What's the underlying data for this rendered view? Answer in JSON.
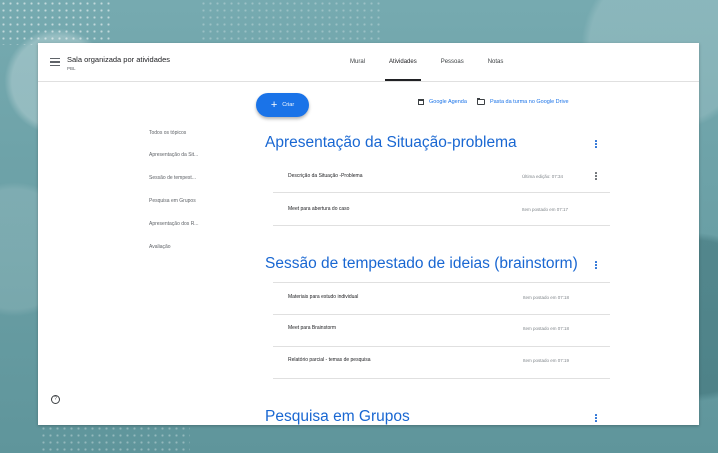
{
  "header": {
    "class_name": "Sala organizada por atividades",
    "class_sub": "PBL"
  },
  "tabs": [
    {
      "label": "Mural"
    },
    {
      "label": "Atividades"
    },
    {
      "label": "Pessoas"
    },
    {
      "label": "Notas"
    }
  ],
  "actions": {
    "create_label": "Criar",
    "calendar_link": "Google Agenda",
    "drive_link": "Pasta da turma no Google Drive"
  },
  "topics": [
    "Todos os tópicos",
    "Apresentação da Sit...",
    "Sessão de tempest...",
    "Pesquisa em Grupos",
    "Apresentação dos R...",
    "Avaliação"
  ],
  "sections": [
    {
      "title": "Apresentação da Situação-problema",
      "items": [
        {
          "title": "Descrição da Situação -Problema",
          "meta": "Última edição: 07:34"
        },
        {
          "title": "Meet para abertura do caso",
          "meta": "Item postado em 07:17"
        }
      ]
    },
    {
      "title": "Sessão de tempestado de ideias (brainstorm)",
      "items": [
        {
          "title": "Materiais para estudo individual",
          "meta": "Item postado em 07:18"
        },
        {
          "title": "Meet para Brainstorm",
          "meta": "Item postado em 07:18"
        },
        {
          "title": "Relatório parcial - temas de pesquisa",
          "meta": "Item postado em 07:19"
        }
      ]
    },
    {
      "title": "Pesquisa em Grupos",
      "items": []
    }
  ],
  "colors": {
    "accent": "#1a73e8",
    "section_title": "#1967d2",
    "background": "#6b9fa5"
  }
}
